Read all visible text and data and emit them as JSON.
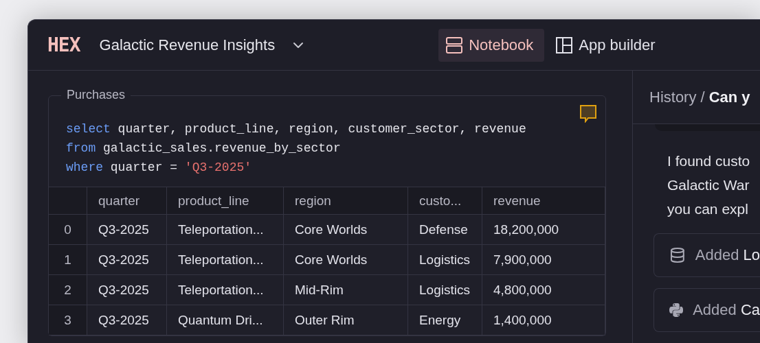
{
  "header": {
    "logo": "HEX",
    "title": "Galactic Revenue Insights",
    "tabs": [
      {
        "label": "Notebook",
        "kind": "notebook",
        "selected": true
      },
      {
        "label": "App builder",
        "kind": "layout",
        "selected": false
      }
    ]
  },
  "cell": {
    "label": "Purchases",
    "code": [
      [
        {
          "kind": "keyword",
          "text": "select"
        },
        {
          "kind": "plain",
          "text": " quarter, product_line, region, customer_sector, revenue"
        }
      ],
      [
        {
          "kind": "keyword",
          "text": "from"
        },
        {
          "kind": "plain",
          "text": " galactic_sales.revenue_by_sector"
        }
      ],
      [
        {
          "kind": "keyword",
          "text": "where"
        },
        {
          "kind": "plain",
          "text": " quarter = "
        },
        {
          "kind": "string",
          "text": "'Q3-2025'"
        }
      ]
    ],
    "table": {
      "columns": [
        "quarter",
        "product_line",
        "region",
        "custo...",
        "revenue"
      ],
      "rows": [
        {
          "index": "0",
          "cells": [
            "Q3-2025",
            "Teleportation...",
            "Core Worlds",
            "Defense",
            "18,200,000"
          ]
        },
        {
          "index": "1",
          "cells": [
            "Q3-2025",
            "Teleportation...",
            "Core Worlds",
            "Logistics",
            "7,900,000"
          ]
        },
        {
          "index": "2",
          "cells": [
            "Q3-2025",
            "Teleportation...",
            "Mid-Rim",
            "Logistics",
            "4,800,000"
          ]
        },
        {
          "index": "3",
          "cells": [
            "Q3-2025",
            "Quantum Dri...",
            "Outer Rim",
            "Energy",
            "1,400,000"
          ]
        }
      ]
    }
  },
  "history": {
    "breadcrumb": "History /",
    "current": "Can y",
    "message_lines": [
      "I found custo",
      "Galactic War",
      "you can expl"
    ],
    "actions": [
      {
        "kind": "database",
        "text": "Added **Lo**"
      },
      {
        "kind": "python",
        "text": "Added **Ca**"
      }
    ]
  }
}
